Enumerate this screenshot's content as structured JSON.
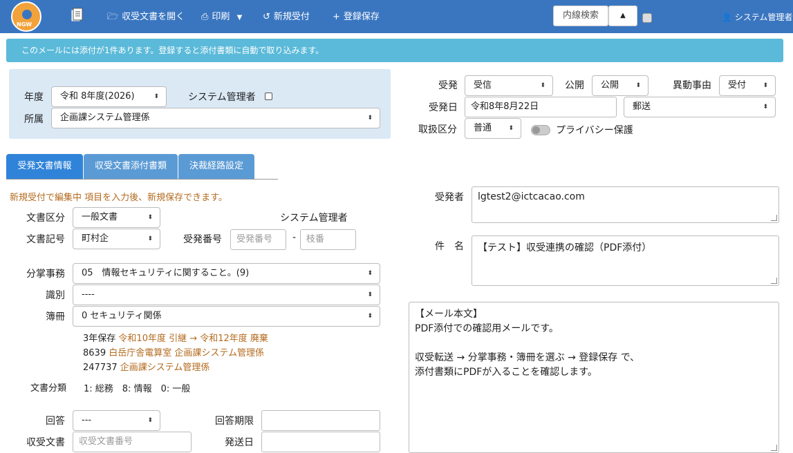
{
  "topbar": {
    "logo_text": "NGW",
    "items": [
      {
        "icon": "document-icon",
        "label": ""
      },
      {
        "icon": "folder-open-icon",
        "label": "収受文書を開く"
      },
      {
        "icon": "printer-icon",
        "label": "印刷"
      },
      {
        "icon": "refresh-icon",
        "label": "新規受付"
      },
      {
        "icon": "plus-icon",
        "label": "登録保存"
      }
    ],
    "search_label": "内線検索",
    "user_label": "システム管理者"
  },
  "alert": "このメールには添付が1件あります。登録すると添付書類に自動で取り込みます。",
  "context": {
    "year_label": "年度",
    "year_value": "令和 8年度(2026)",
    "admin_label": "システム管理者",
    "dept_label": "所属",
    "dept_value": "企画課システム管理係"
  },
  "meta": {
    "juhatsu_label": "受発",
    "juhatsu_value": "受信",
    "kokai_label": "公開",
    "kokai_value": "公開",
    "ido_label": "異動事由",
    "ido_value": "受付",
    "date_label": "受発日",
    "date_value": "令和8年8月22日",
    "method_value": "郵送",
    "toriatsukai_label": "取扱区分",
    "toriatsukai_value": "普通",
    "privacy_label": "プライバシー保護"
  },
  "tabs": [
    "受発文書情報",
    "収受文書添付書類",
    "決裁経路設定"
  ],
  "form": {
    "note": "新規受付で編集中 項目を入力後、新規保存できます。",
    "bunsho_kubun_label": "文書区分",
    "bunsho_kubun_value": "一般文書",
    "owner_label": "システム管理者",
    "bunsho_kigo_label": "文書記号",
    "bunsho_kigo_value": "町村企",
    "juhatsu_no_label": "受発番号",
    "juhatsu_no_placeholder": "受発番号",
    "dash": "-",
    "edaban_placeholder": "枝番",
    "bunsho_jimu_label": "分掌事務",
    "bunsho_jimu_value": "05　情報セキュリティに関すること。(9)",
    "shikibetsu_label": "識別",
    "shikibetsu_value": "----",
    "bosatsu_label": "簿冊",
    "bosatsu_value": "0 セキュリティ関係",
    "info1_a": "3年保存",
    "info1_b": "令和10年度 引継 →  令和12年度 廃棄",
    "info2_a": "8639",
    "info2_b": "白岳庁舎電算室 企画課システム管理係",
    "info3_a": "247737",
    "info3_b": "企画課システム管理係",
    "bunrui_label": "文書分類",
    "bunrui_value": "1: 総務　8: 情報　0: 一般",
    "kaito_label": "回答",
    "kaito_value": "---",
    "kaito_kigen_label": "回答期限",
    "shuju_label": "収受文書",
    "shuju_placeholder": "収受文書番号",
    "hasso_label": "発送日"
  },
  "right": {
    "sender_label": "受発者",
    "sender_value": "lgtest2@ictcacao.com",
    "subject_label": "件　名",
    "subject_value": "【テスト】収受連携の確認（PDF添付）",
    "body_lines": [
      "【メール本文】",
      "PDF添付での確認用メールです。",
      "",
      "収受転送 → 分掌事務・簿冊を選ぶ → 登録保存 で、",
      "添付書類にPDFが入ることを確認します。"
    ]
  }
}
